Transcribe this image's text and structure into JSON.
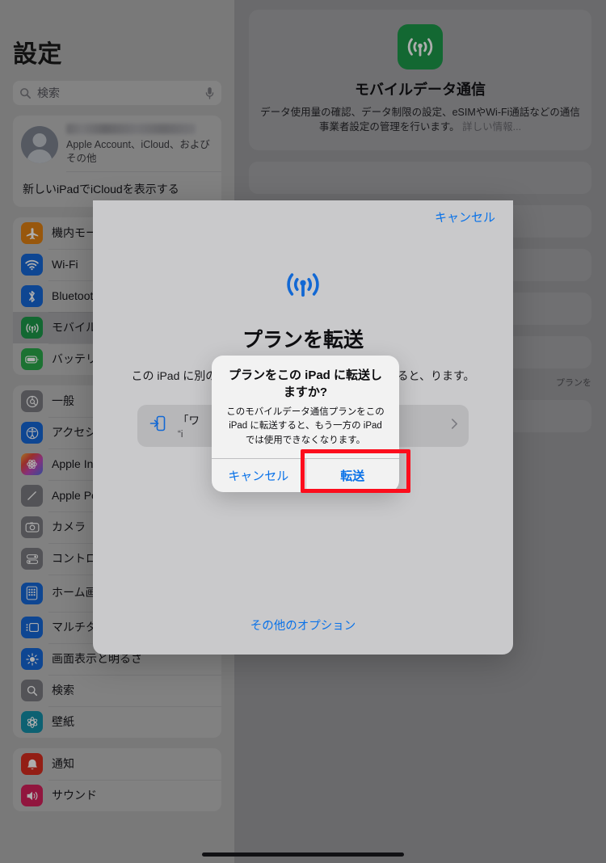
{
  "sidebar": {
    "title": "設定",
    "search": {
      "placeholder": "検索",
      "search_icon": "search-icon",
      "mic_icon": "microphone-icon"
    },
    "account": {
      "name_redacted": "",
      "subtitle": "Apple Account、iCloud、および\nその他",
      "cta": "新しいiPadでiCloudを表示する"
    },
    "groups": [
      {
        "items": [
          {
            "label": "機内モード",
            "icon": "airplane-icon",
            "color": "#e08012",
            "selected": false
          },
          {
            "label": "Wi-Fi",
            "icon": "wifi-icon",
            "color": "#1667d8",
            "selected": false
          },
          {
            "label": "Bluetooth",
            "icon": "bluetooth-icon",
            "color": "#1667d8",
            "selected": false
          },
          {
            "label": "モバイルデータ通信",
            "icon": "cellular-icon",
            "color": "#1d9a4a",
            "selected": true
          },
          {
            "label": "バッテリー",
            "icon": "battery-icon",
            "color": "#2aa84a",
            "selected": false
          }
        ]
      },
      {
        "items": [
          {
            "label": "一般",
            "icon": "gear-icon",
            "color": "#7b7b80",
            "selected": false
          },
          {
            "label": "アクセシビリティ",
            "icon": "accessibility-icon",
            "color": "#1667d8",
            "selected": false
          },
          {
            "label": "Apple Intelligence と Siri",
            "icon": "apple-intelligence-icon",
            "color": "#c850c0",
            "selected": false
          },
          {
            "label": "Apple Pencil",
            "icon": "pencil-icon",
            "color": "#7b7b80",
            "selected": false
          },
          {
            "label": "カメラ",
            "icon": "camera-icon",
            "color": "#7b7b80",
            "selected": false
          },
          {
            "label": "コントロールセンター",
            "icon": "control-center-icon",
            "color": "#7b7b80",
            "selected": false
          },
          {
            "label": "ホーム画面とAppライブラリ",
            "icon": "home-screen-icon",
            "color": "#1667d8",
            "selected": false
          },
          {
            "label": "マルチタスクとジェスチャ",
            "icon": "multitasking-icon",
            "color": "#1667d8",
            "selected": false
          },
          {
            "label": "画面表示と明るさ",
            "icon": "brightness-icon",
            "color": "#1667d8",
            "selected": false
          },
          {
            "label": "検索",
            "icon": "search-square-icon",
            "color": "#7b7b80",
            "selected": false
          },
          {
            "label": "壁紙",
            "icon": "wallpaper-icon",
            "color": "#148fa8",
            "selected": false
          }
        ]
      },
      {
        "items": [
          {
            "label": "通知",
            "icon": "notifications-icon",
            "color": "#d92d20",
            "selected": false
          },
          {
            "label": "サウンド",
            "icon": "sound-icon",
            "color": "#d6215c",
            "selected": false
          }
        ]
      }
    ]
  },
  "detail": {
    "header": {
      "icon": "cellular-icon",
      "title": "モバイルデータ通信",
      "description": "データ使用量の確認、データ制限の設定、eSIMやWi-Fi通話などの通信事業者設定の管理を行います。",
      "more_link": "詳しい情報..."
    },
    "background_note": "プランを"
  },
  "transfer_sheet": {
    "cancel_label": "キャンセル",
    "icon": "cellular-icon",
    "title": "プランを転送",
    "body": "この iPad に別の iPad からプランを転送 d に転送 すると、ります。",
    "option_row": {
      "icon": "transfer-in-icon",
      "line1": "「ワ",
      "line2": "“i",
      "chevron": "chevron-right-icon"
    },
    "more_options_label": "その他のオプション"
  },
  "confirm_alert": {
    "title": "プランをこの iPad\nに転送しますか?",
    "message": "このモバイルデータ通信プランをこの iPad に転送すると、もう一方の iPad では使用できなくなります。",
    "cancel_label": "キャンセル",
    "confirm_label": "転送"
  },
  "colors": {
    "accent_blue": "#0a72e8",
    "highlight_red": "#fc0d1c",
    "cellular_green": "#1d9a4a"
  }
}
